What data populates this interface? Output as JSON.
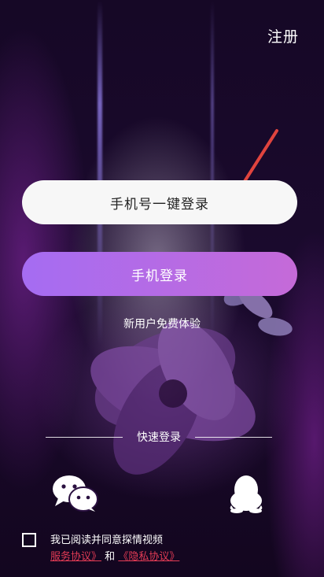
{
  "header": {
    "register_label": "注册"
  },
  "login": {
    "one_key_label": "手机号一键登录",
    "phone_label": "手机登录",
    "guest_label": "新用户免费体验"
  },
  "quick_login": {
    "title": "快速登录",
    "options": [
      "wechat-icon",
      "qq-icon"
    ]
  },
  "agreement": {
    "prefix": "我已阅读并同意探情视频",
    "service_link": "服务协议》",
    "connector": "和",
    "privacy_link": "《隐私协议》"
  },
  "colors": {
    "primary_gradient_start": "#a56cf2",
    "primary_gradient_end": "#c56ad8",
    "link": "#e23b55",
    "background": "#160826"
  }
}
